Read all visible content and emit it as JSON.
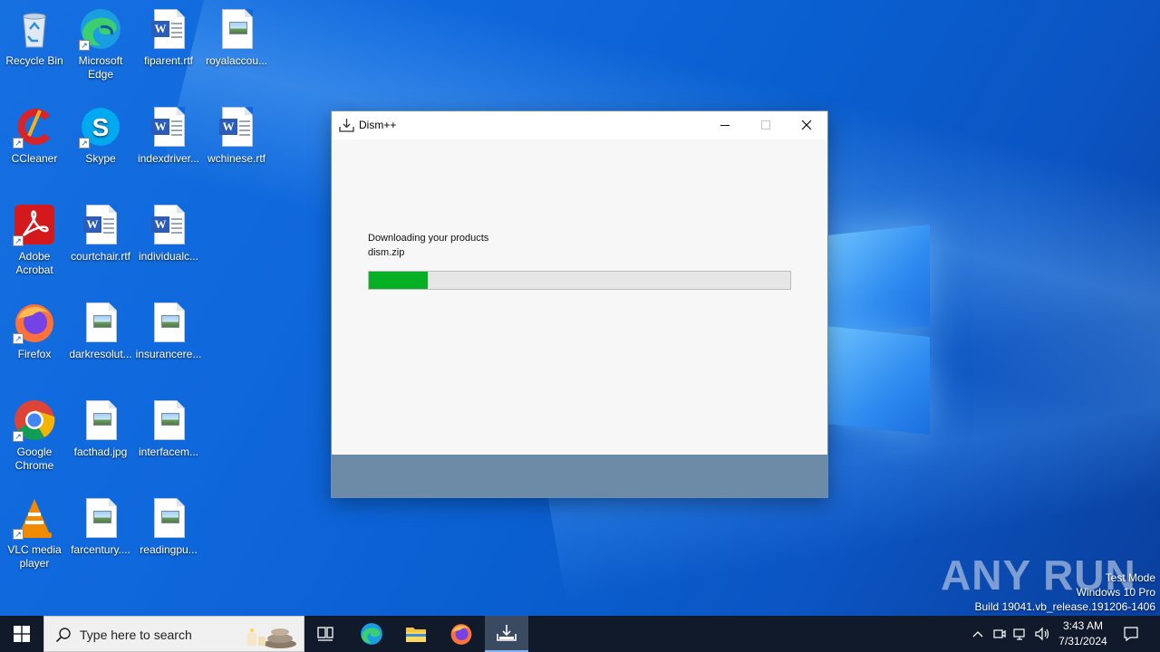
{
  "desktop": {
    "icons": [
      {
        "label": "Recycle Bin",
        "icon": "recycle-bin-icon"
      },
      {
        "label": "Microsoft Edge",
        "icon": "edge-icon"
      },
      {
        "label": "fiparent.rtf",
        "icon": "word-document-icon"
      },
      {
        "label": "royalaccou...",
        "icon": "image-file-icon"
      },
      {
        "label": "CCleaner",
        "icon": "ccleaner-icon"
      },
      {
        "label": "Skype",
        "icon": "skype-icon"
      },
      {
        "label": "indexdriver...",
        "icon": "word-document-icon"
      },
      {
        "label": "wchinese.rtf",
        "icon": "word-document-icon"
      },
      {
        "label": "Adobe Acrobat",
        "icon": "acrobat-icon"
      },
      {
        "label": "courtchair.rtf",
        "icon": "word-document-icon"
      },
      {
        "label": "individualc...",
        "icon": "word-document-icon"
      },
      {
        "label": "Firefox",
        "icon": "firefox-icon"
      },
      {
        "label": "darkresolut...",
        "icon": "image-file-icon"
      },
      {
        "label": "insurancere...",
        "icon": "image-file-icon"
      },
      {
        "label": "Google Chrome",
        "icon": "chrome-icon"
      },
      {
        "label": "facthad.jpg",
        "icon": "image-file-icon"
      },
      {
        "label": "interfacem...",
        "icon": "image-file-icon"
      },
      {
        "label": "VLC media player",
        "icon": "vlc-icon"
      },
      {
        "label": "farcentury....",
        "icon": "image-file-icon"
      },
      {
        "label": "readingpu...",
        "icon": "image-file-icon"
      }
    ]
  },
  "window": {
    "title": "Dism++",
    "status_text": "Downloading your products",
    "file_name": "dism.zip",
    "progress_fraction": 0.14,
    "progress_color": "#06b025",
    "footer_color": "#6b8ba6"
  },
  "watermark": {
    "brand": "ANY RUN",
    "mode": "Test Mode",
    "edition": "Windows 10 Pro",
    "build": "Build 19041.vb_release.191206-1406"
  },
  "taskbar": {
    "search_placeholder": "Type here to search",
    "time": "3:43 AM",
    "date": "7/31/2024",
    "pinned": [
      "task-view-icon",
      "edge-icon",
      "file-explorer-icon",
      "firefox-icon",
      "dism-icon"
    ]
  }
}
